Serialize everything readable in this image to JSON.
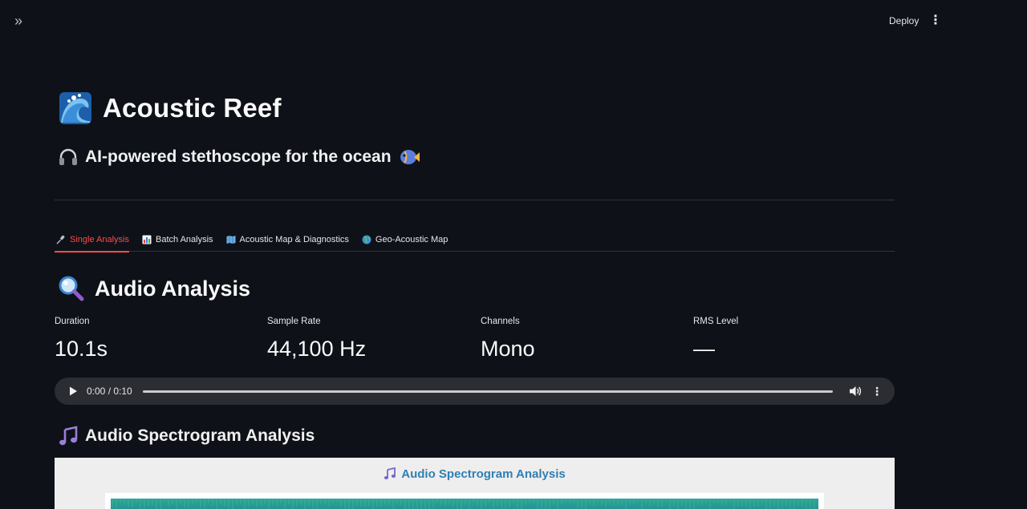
{
  "toolbar": {
    "deploy_label": "Deploy",
    "expand_icon": "double-chevron-right-icon",
    "menu_icon": "kebab-menu-icon"
  },
  "header": {
    "title": "Acoustic Reef",
    "title_icon": "water-wave-icon",
    "subtitle": "AI-powered stethoscope for the ocean",
    "subtitle_icons": [
      "headphones-icon",
      "tropical-fish-icon"
    ]
  },
  "tabs": [
    {
      "label": "Single Analysis",
      "icon": "microphone-icon",
      "active": true
    },
    {
      "label": "Batch Analysis",
      "icon": "bar-chart-icon",
      "active": false
    },
    {
      "label": "Acoustic Map & Diagnostics",
      "icon": "map-icon",
      "active": false
    },
    {
      "label": "Geo-Acoustic Map",
      "icon": "globe-icon",
      "active": false
    }
  ],
  "analysis": {
    "heading": "Audio Analysis",
    "heading_icon": "magnifying-glass-icon",
    "metrics": [
      {
        "label": "Duration",
        "value": "10.1s"
      },
      {
        "label": "Sample Rate",
        "value": "44,100 Hz"
      },
      {
        "label": "Channels",
        "value": "Mono"
      },
      {
        "label": "RMS Level",
        "value": "—"
      }
    ]
  },
  "audio_player": {
    "time": "0:00 / 0:10",
    "progress": 0
  },
  "spectrogram": {
    "heading": "Audio Spectrogram Analysis",
    "heading_icon": "musical-notes-icon",
    "figure_title": "Audio Spectrogram Analysis"
  },
  "colors": {
    "background": "#0e1117",
    "accent": "#ff4b4b",
    "figure_title": "#2f7fb4"
  }
}
